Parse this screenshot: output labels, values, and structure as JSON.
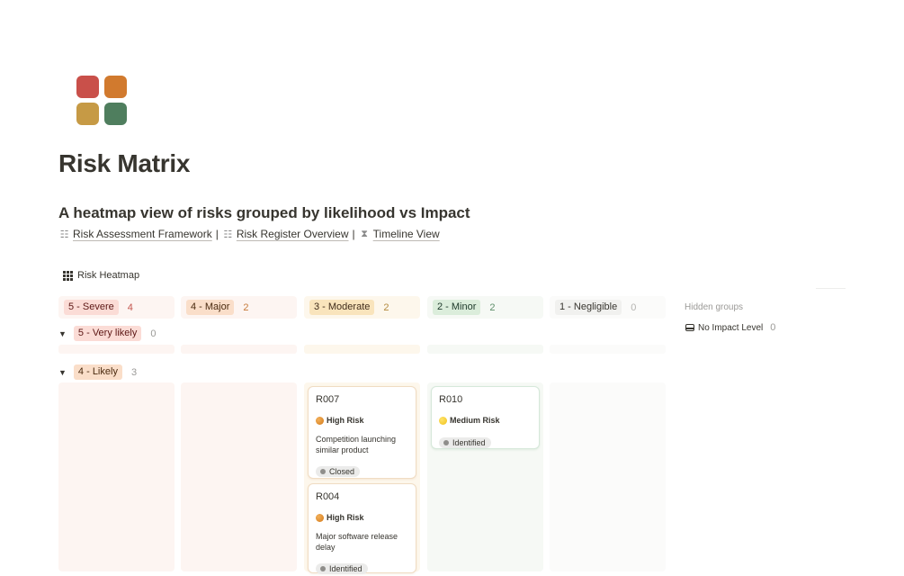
{
  "page": {
    "title": "Risk Matrix",
    "subtitle": "A heatmap view of risks grouped by likelihood vs Impact",
    "links": [
      {
        "label": "Risk Assessment Framework",
        "icon": "books-emoji-icon"
      },
      {
        "label": "Risk Register Overview",
        "icon": "books-emoji-icon"
      },
      {
        "label": "Timeline View",
        "icon": "hourglass-emoji-icon"
      }
    ],
    "separator": "|"
  },
  "view": {
    "label": "Risk Heatmap",
    "icon": "grid-icon"
  },
  "columns": [
    {
      "label": "5 - Severe",
      "count": "4",
      "tag_bg": "#fbdcd6",
      "tag_color": "#5d1715",
      "head_bg": "#fdf5f2",
      "count_color": "#c4554d"
    },
    {
      "label": "4 - Major",
      "count": "2",
      "tag_bg": "#fadec9",
      "tag_color": "#49290e",
      "head_bg": "#fdf5f2",
      "count_color": "#c67a3a"
    },
    {
      "label": "3 - Moderate",
      "count": "2",
      "tag_bg": "#f9e4bc",
      "tag_color": "#402c1b",
      "head_bg": "#fdf7ec",
      "count_color": "#b38a3e"
    },
    {
      "label": "2 - Minor",
      "count": "2",
      "tag_bg": "#dbeddb",
      "tag_color": "#1c3829",
      "head_bg": "#f6f9f5",
      "count_color": "#5e8e6a"
    },
    {
      "label": "1 - Negligible",
      "count": "0",
      "tag_bg": "#f1f1ef",
      "tag_color": "#37352f",
      "head_bg": "#fbfbfa",
      "count_color": "#b5b4b1"
    }
  ],
  "groups": [
    {
      "label": "5 - Very likely",
      "count": "0",
      "tag_bg": "#fbdcd6",
      "tag_color": "#5d1715"
    },
    {
      "label": "4 - Likely",
      "count": "3",
      "tag_bg": "#fadec9",
      "tag_color": "#49290e"
    }
  ],
  "cards": [
    {
      "id": "R007",
      "level": "High Risk",
      "description": "Competition launching similar product",
      "status": "Closed"
    },
    {
      "id": "R004",
      "level": "High Risk",
      "description": "Major software release delay",
      "status": "Identified"
    },
    {
      "id": "R010",
      "level": "Medium Risk",
      "status": "Identified"
    }
  ],
  "hidden": {
    "title": "Hidden groups",
    "items": [
      {
        "label": "No Impact Level",
        "count": "0",
        "icon": "inbox-icon"
      }
    ]
  }
}
